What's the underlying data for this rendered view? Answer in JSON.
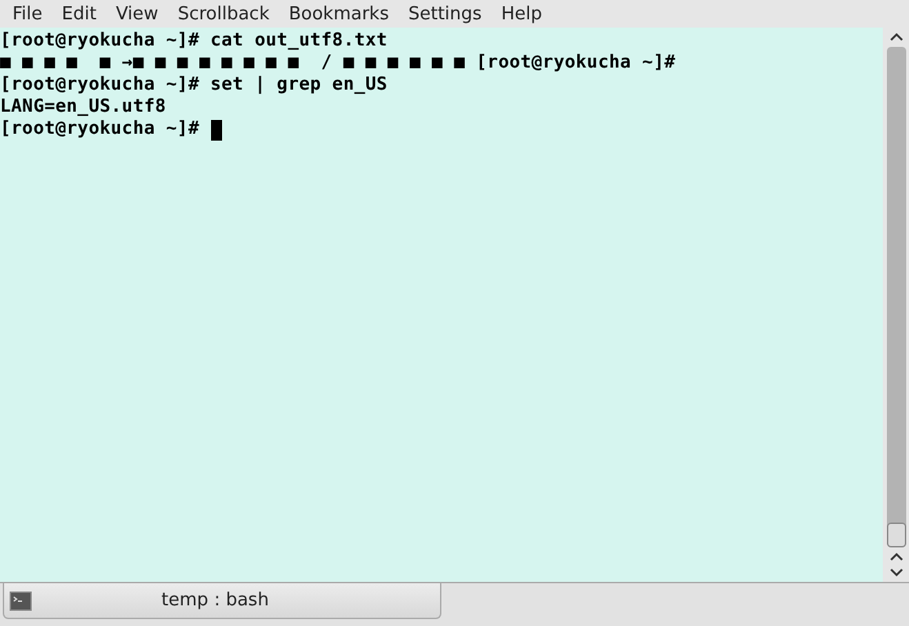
{
  "menu": [
    "File",
    "Edit",
    "View",
    "Scrollback",
    "Bookmarks",
    "Settings",
    "Help"
  ],
  "terminal": {
    "lines": [
      "[root@ryokucha ~]# cat out_utf8.txt",
      "■ ■ ■ ■  ■ →■ ■ ■ ■ ■ ■ ■ ■  / ■ ■ ■ ■ ■ ■ [root@ryokucha ~]#",
      "[root@ryokucha ~]# set | grep en_US",
      "LANG=en_US.utf8",
      "[root@ryokucha ~]# "
    ]
  },
  "tabs": [
    {
      "label": "temp : bash",
      "selected": true
    }
  ]
}
